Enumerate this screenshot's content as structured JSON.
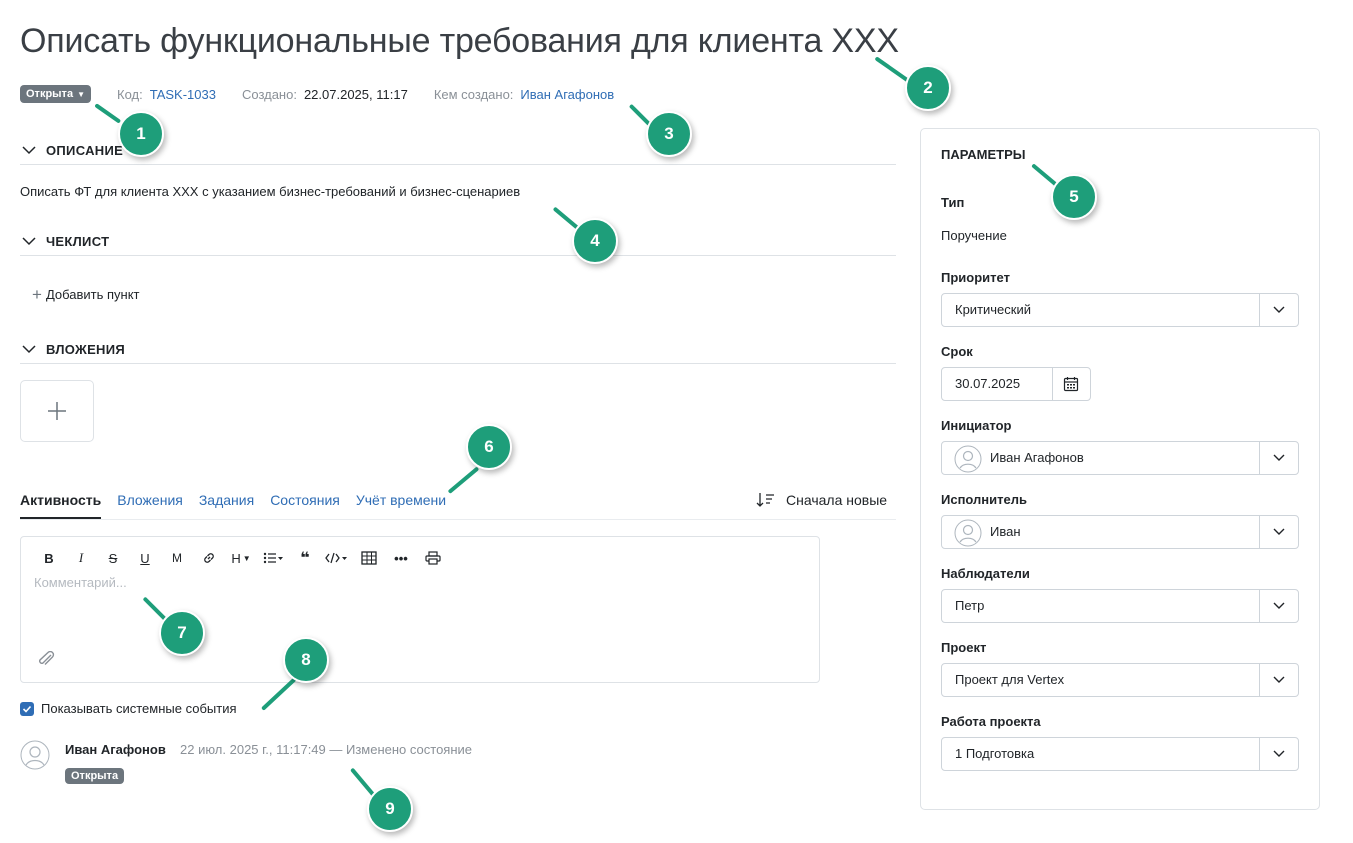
{
  "task": {
    "title": "Описать функциональные требования для клиента XXX",
    "status_badge": "Открыта",
    "code_label": "Код:",
    "code_value": "TASK-1033",
    "created_label": "Создано:",
    "created_value": "22.07.2025, 11:17",
    "author_label": "Кем создано:",
    "author_value": "Иван Агафонов"
  },
  "sections": {
    "description_title": "ОПИСАНИЕ",
    "description_text": "Описать ФТ для клиента XXX с указанием бизнес-требований и бизнес-сценариев",
    "checklist_title": "ЧЕКЛИСТ",
    "add_item_label": "Добавить пункт",
    "attachments_title": "ВЛОЖЕНИЯ"
  },
  "tabs": [
    {
      "label": "Активность",
      "active": true
    },
    {
      "label": "Вложения",
      "active": false
    },
    {
      "label": "Задания",
      "active": false
    },
    {
      "label": "Состояния",
      "active": false
    },
    {
      "label": "Учёт времени",
      "active": false
    }
  ],
  "sort_label": "Сначала новые",
  "editor": {
    "placeholder": "Комментарий...",
    "toolbar": [
      "B",
      "I",
      "S",
      "U",
      "M",
      "link-icon",
      "H",
      "list-icon",
      "quote-icon",
      "code-icon",
      "table-icon",
      "more-icon",
      "print-icon"
    ]
  },
  "system_events_label": "Показывать системные события",
  "activity": [
    {
      "author": "Иван Агафонов",
      "info": "22 июл. 2025 г., 11:17:49 — Изменено состояние",
      "badge": "Открыта"
    }
  ],
  "panel": {
    "title": "ПАРАМЕТРЫ",
    "type_label": "Тип",
    "type_value": "Поручение",
    "priority_label": "Приоритет",
    "priority_value": "Критический",
    "deadline_label": "Срок",
    "deadline_value": "30.07.2025",
    "initiator_label": "Инициатор",
    "initiator_value": "Иван Агафонов",
    "assignee_label": "Исполнитель",
    "assignee_value": "Иван",
    "watchers_label": "Наблюдатели",
    "watchers_value": "Петр",
    "project_label": "Проект",
    "project_value": "Проект для Vertex",
    "project_work_label": "Работа проекта",
    "project_work_value": "1 Подготовка"
  },
  "markers": [
    "1",
    "2",
    "3",
    "4",
    "5",
    "6",
    "7",
    "8",
    "9"
  ],
  "colors": {
    "link": "#2f6db5",
    "badge": "#6c757d",
    "marker": "#1e9e7a",
    "border": "#dee2e6"
  }
}
